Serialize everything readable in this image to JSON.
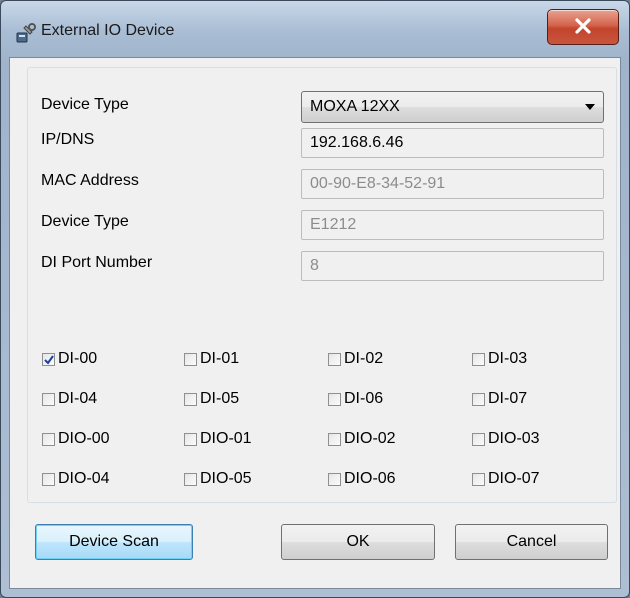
{
  "window": {
    "title": "External IO Device",
    "icon": "device-wrench-icon",
    "close_icon": "close-x-icon"
  },
  "form": {
    "device_type": {
      "label": "Device Type",
      "value": "MOXA 12XX"
    },
    "ip_dns": {
      "label": "IP/DNS",
      "value": "192.168.6.46"
    },
    "mac_address": {
      "label": "MAC Address",
      "value": "00-90-E8-34-52-91"
    },
    "model": {
      "label": "Device Type",
      "value": "E1212"
    },
    "di_port_number": {
      "label": "DI Port Number",
      "value": "8"
    }
  },
  "checkboxes": [
    {
      "label": "DI-00",
      "checked": true
    },
    {
      "label": "DI-01",
      "checked": false
    },
    {
      "label": "DI-02",
      "checked": false
    },
    {
      "label": "DI-03",
      "checked": false
    },
    {
      "label": "DI-04",
      "checked": false
    },
    {
      "label": "DI-05",
      "checked": false
    },
    {
      "label": "DI-06",
      "checked": false
    },
    {
      "label": "DI-07",
      "checked": false
    },
    {
      "label": "DIO-00",
      "checked": false
    },
    {
      "label": "DIO-01",
      "checked": false
    },
    {
      "label": "DIO-02",
      "checked": false
    },
    {
      "label": "DIO-03",
      "checked": false
    },
    {
      "label": "DIO-04",
      "checked": false
    },
    {
      "label": "DIO-05",
      "checked": false
    },
    {
      "label": "DIO-06",
      "checked": false
    },
    {
      "label": "DIO-07",
      "checked": false
    }
  ],
  "buttons": {
    "scan": "Device Scan",
    "ok": "OK",
    "cancel": "Cancel"
  },
  "colors": {
    "default_button_border": "#3c7fb1",
    "close_button": "#c2442c",
    "check_mark": "#1d3f9a"
  }
}
